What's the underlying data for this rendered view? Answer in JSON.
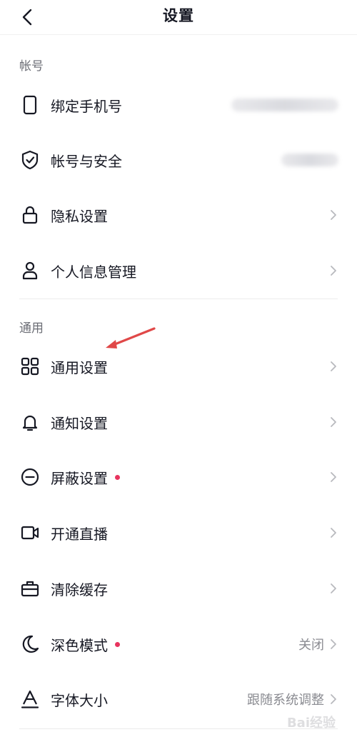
{
  "header": {
    "title": "设置"
  },
  "sections": [
    {
      "title": "帐号"
    },
    {
      "title": "通用"
    }
  ],
  "rows": {
    "bind_phone": {
      "label": "绑定手机号",
      "icon": "phone-icon"
    },
    "account_security": {
      "label": "帐号与安全",
      "icon": "shield-check-icon"
    },
    "privacy": {
      "label": "隐私设置",
      "icon": "lock-icon"
    },
    "personal_info": {
      "label": "个人信息管理",
      "icon": "person-icon"
    },
    "general": {
      "label": "通用设置",
      "icon": "grid-icon"
    },
    "notification": {
      "label": "通知设置",
      "icon": "bell-icon"
    },
    "block": {
      "label": "屏蔽设置",
      "icon": "minus-circle-icon",
      "badge_color": "#e8345e"
    },
    "live": {
      "label": "开通直播",
      "icon": "video-camera-icon"
    },
    "cache": {
      "label": "清除缓存",
      "icon": "toolbox-icon"
    },
    "dark_mode": {
      "label": "深色模式",
      "icon": "moon-icon",
      "value": "关闭",
      "badge_color": "#e8345e"
    },
    "font_size": {
      "label": "字体大小",
      "icon": "font-a-icon",
      "value": "跟随系统调整"
    }
  },
  "watermark": {
    "text": "Bai经验"
  },
  "colors": {
    "accent_dot": "#e8345e",
    "annotation_arrow": "#e04848"
  }
}
